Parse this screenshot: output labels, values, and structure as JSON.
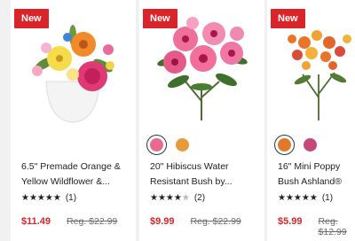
{
  "products": [
    {
      "badge": "New",
      "title": "6.5\" Premade Orange & Yellow Wildflower &...",
      "stars_filled": 5,
      "stars_total": 5,
      "reviews": "(1)",
      "sale_price": "$11.49",
      "regular_price": "Reg. $22.99",
      "image": "flower-pot-arrangement-image"
    },
    {
      "badge": "New",
      "title": "20\" Hibiscus Water Resistant Bush by...",
      "stars_filled": 4,
      "stars_total": 5,
      "reviews": "(2)",
      "sale_price": "$9.99",
      "regular_price": "Reg. $22.99",
      "image": "hibiscus-bush-image",
      "swatches": [
        {
          "color": "#e86b8e",
          "selected": true
        },
        {
          "color": "#e89a3a",
          "selected": false
        }
      ]
    },
    {
      "badge": "New",
      "title": "16\" Mini Poppy Bush Ashland®",
      "stars_filled": 5,
      "stars_total": 5,
      "reviews": "(1)",
      "sale_price": "$5.99",
      "regular_price": "Reg. $12.99",
      "image": "mini-poppy-bush-image",
      "swatches": [
        {
          "color": "#e0792a",
          "selected": true
        },
        {
          "color": "#c6487a",
          "selected": false
        }
      ]
    }
  ],
  "colors": {
    "sale": "#d9242a",
    "badge": "#d9242a",
    "background": "#f1f1f1"
  }
}
